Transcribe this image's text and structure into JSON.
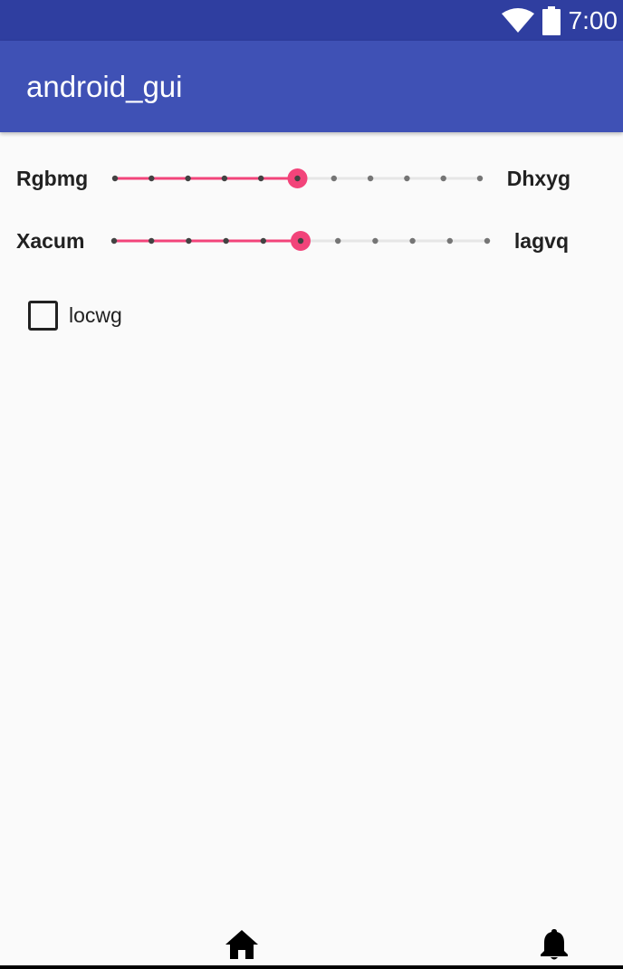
{
  "status_bar": {
    "time": "7:00",
    "icons": [
      "wifi-icon",
      "battery-icon"
    ]
  },
  "app_bar": {
    "title": "android_gui"
  },
  "sliders": [
    {
      "left_label": "Rgbmg",
      "right_label": "Dhxyg",
      "steps": 10,
      "value": 5
    },
    {
      "left_label": "Xacum",
      "right_label": "lagvq",
      "steps": 10,
      "value": 5
    }
  ],
  "checkbox": {
    "label": "locwg",
    "checked": false
  },
  "bottom_nav": {
    "items": [
      "home-icon",
      "bell-icon"
    ]
  },
  "colors": {
    "status_bar": "#2F3EA0",
    "app_bar": "#3F51B5",
    "accent": "#F2447A",
    "background": "#FAFAFA"
  }
}
